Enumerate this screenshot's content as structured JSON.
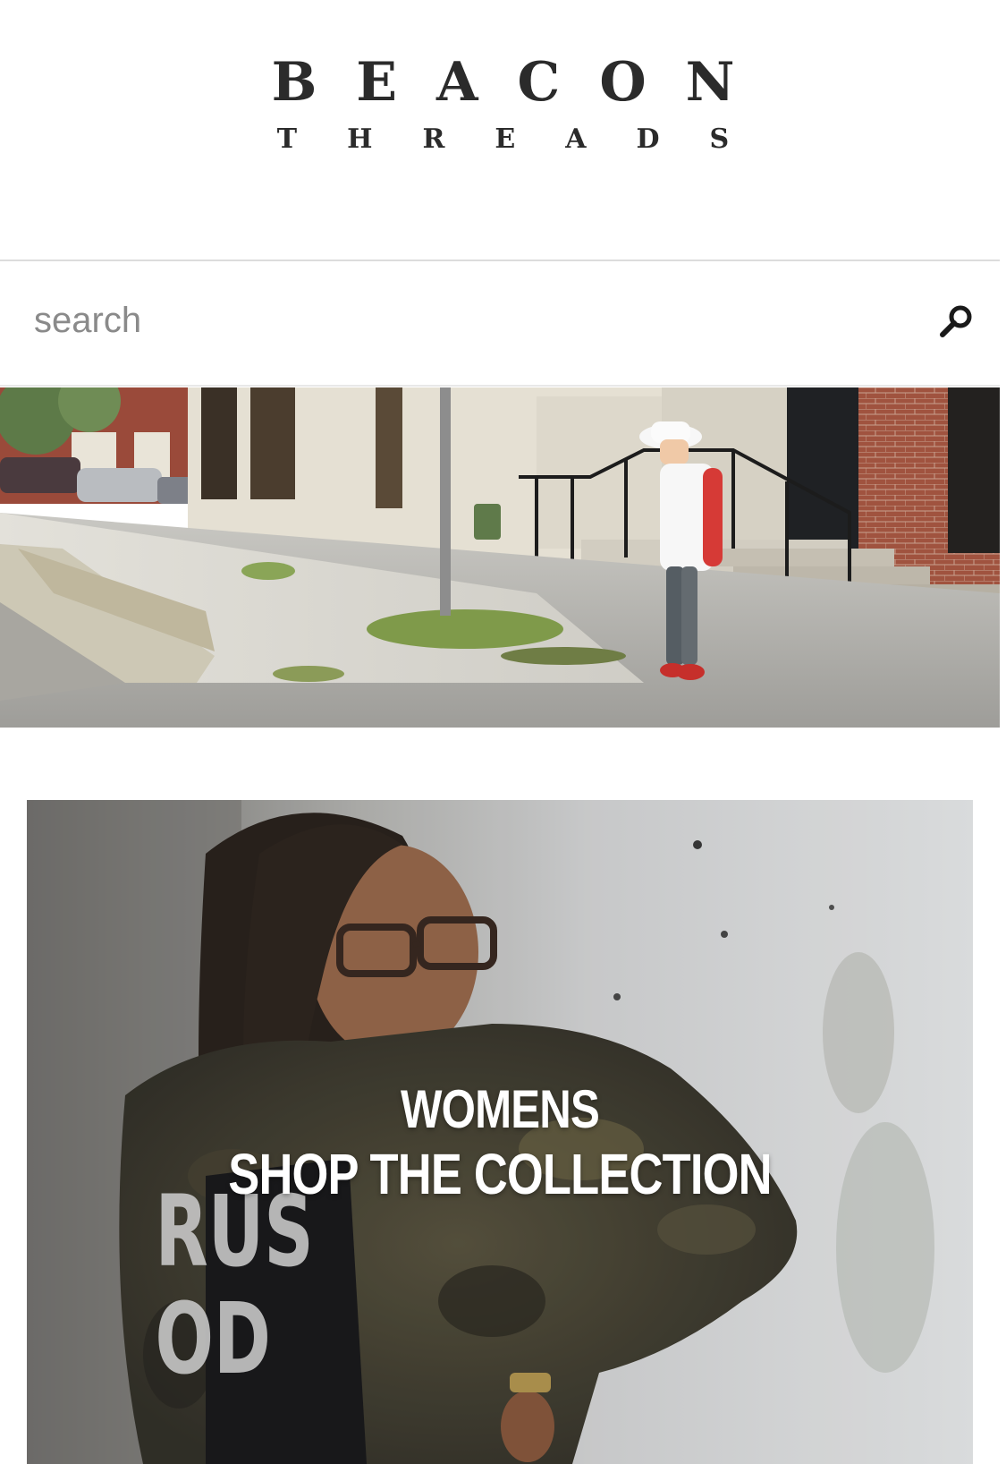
{
  "brand": {
    "name": "BEACON",
    "tagline": "THREADS"
  },
  "search": {
    "placeholder": "search",
    "value": "",
    "icon": "magnifier-icon"
  },
  "hero": {
    "icon": "street-photo"
  },
  "collections": [
    {
      "line1": "WOMENS",
      "line2": "SHOP THE COLLECTION"
    }
  ],
  "colors": {
    "logo": "#2b2b2b",
    "placeholder": "#8a8a8a",
    "divider": "#dcdcdc",
    "caption": "#ffffff"
  }
}
